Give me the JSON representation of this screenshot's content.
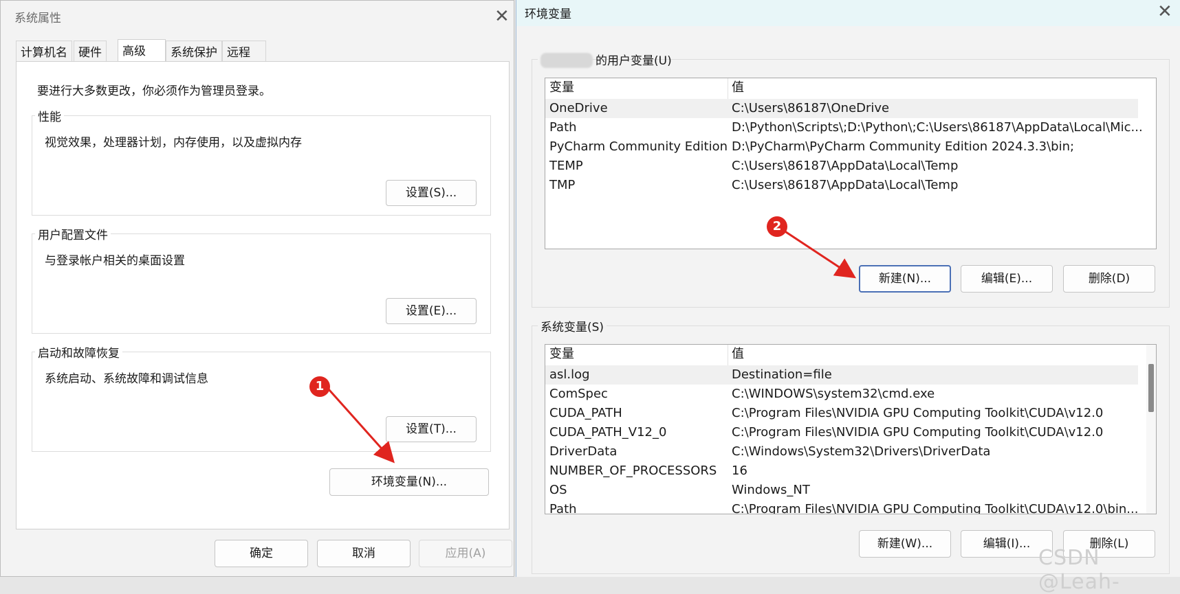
{
  "system_properties": {
    "title": "系统属性",
    "tabs": [
      "计算机名",
      "硬件",
      "高级",
      "系统保护",
      "远程"
    ],
    "active_tab": "高级",
    "admin_note": "要进行大多数更改，你必须作为管理员登录。",
    "performance": {
      "legend": "性能",
      "description": "视觉效果，处理器计划，内存使用，以及虚拟内存",
      "button": "设置(S)..."
    },
    "user_profiles": {
      "legend": "用户配置文件",
      "description": "与登录帐户相关的桌面设置",
      "button": "设置(E)..."
    },
    "startup_recovery": {
      "legend": "启动和故障恢复",
      "description": "系统启动、系统故障和调试信息",
      "button": "设置(T)..."
    },
    "env_button": "环境变量(N)...",
    "ok": "确定",
    "cancel": "取消",
    "apply": "应用(A)"
  },
  "environment_variables": {
    "title": "环境变量",
    "user_section_label": "的用户变量(U)",
    "columns": [
      "变量",
      "值"
    ],
    "user_vars": [
      {
        "name": "OneDrive",
        "value": "C:\\Users\\86187\\OneDrive"
      },
      {
        "name": "Path",
        "value": "D:\\Python\\Scripts\\;D:\\Python\\;C:\\Users\\86187\\AppData\\Local\\Mic..."
      },
      {
        "name": "PyCharm Community Edition",
        "value": "D:\\PyCharm\\PyCharm Community Edition 2024.3.3\\bin;"
      },
      {
        "name": "TEMP",
        "value": "C:\\Users\\86187\\AppData\\Local\\Temp"
      },
      {
        "name": "TMP",
        "value": "C:\\Users\\86187\\AppData\\Local\\Temp"
      }
    ],
    "user_buttons": {
      "new": "新建(N)...",
      "edit": "编辑(E)...",
      "delete": "删除(D)"
    },
    "system_section_label": "系统变量(S)",
    "system_vars": [
      {
        "name": "asl.log",
        "value": "Destination=file"
      },
      {
        "name": "ComSpec",
        "value": "C:\\WINDOWS\\system32\\cmd.exe"
      },
      {
        "name": "CUDA_PATH",
        "value": "C:\\Program Files\\NVIDIA GPU Computing Toolkit\\CUDA\\v12.0"
      },
      {
        "name": "CUDA_PATH_V12_0",
        "value": "C:\\Program Files\\NVIDIA GPU Computing Toolkit\\CUDA\\v12.0"
      },
      {
        "name": "DriverData",
        "value": "C:\\Windows\\System32\\Drivers\\DriverData"
      },
      {
        "name": "NUMBER_OF_PROCESSORS",
        "value": "16"
      },
      {
        "name": "OS",
        "value": "Windows_NT"
      },
      {
        "name": "Path",
        "value": "C:\\Program Files\\NVIDIA GPU Computing Toolkit\\CUDA\\v12.0\\bin..."
      }
    ],
    "system_buttons": {
      "new": "新建(W)...",
      "edit": "编辑(I)...",
      "delete": "删除(L)"
    }
  },
  "annotations": {
    "marker1": "1",
    "marker2": "2",
    "marker_color": "#e0251f"
  },
  "watermark": "CSDN @Leah-"
}
